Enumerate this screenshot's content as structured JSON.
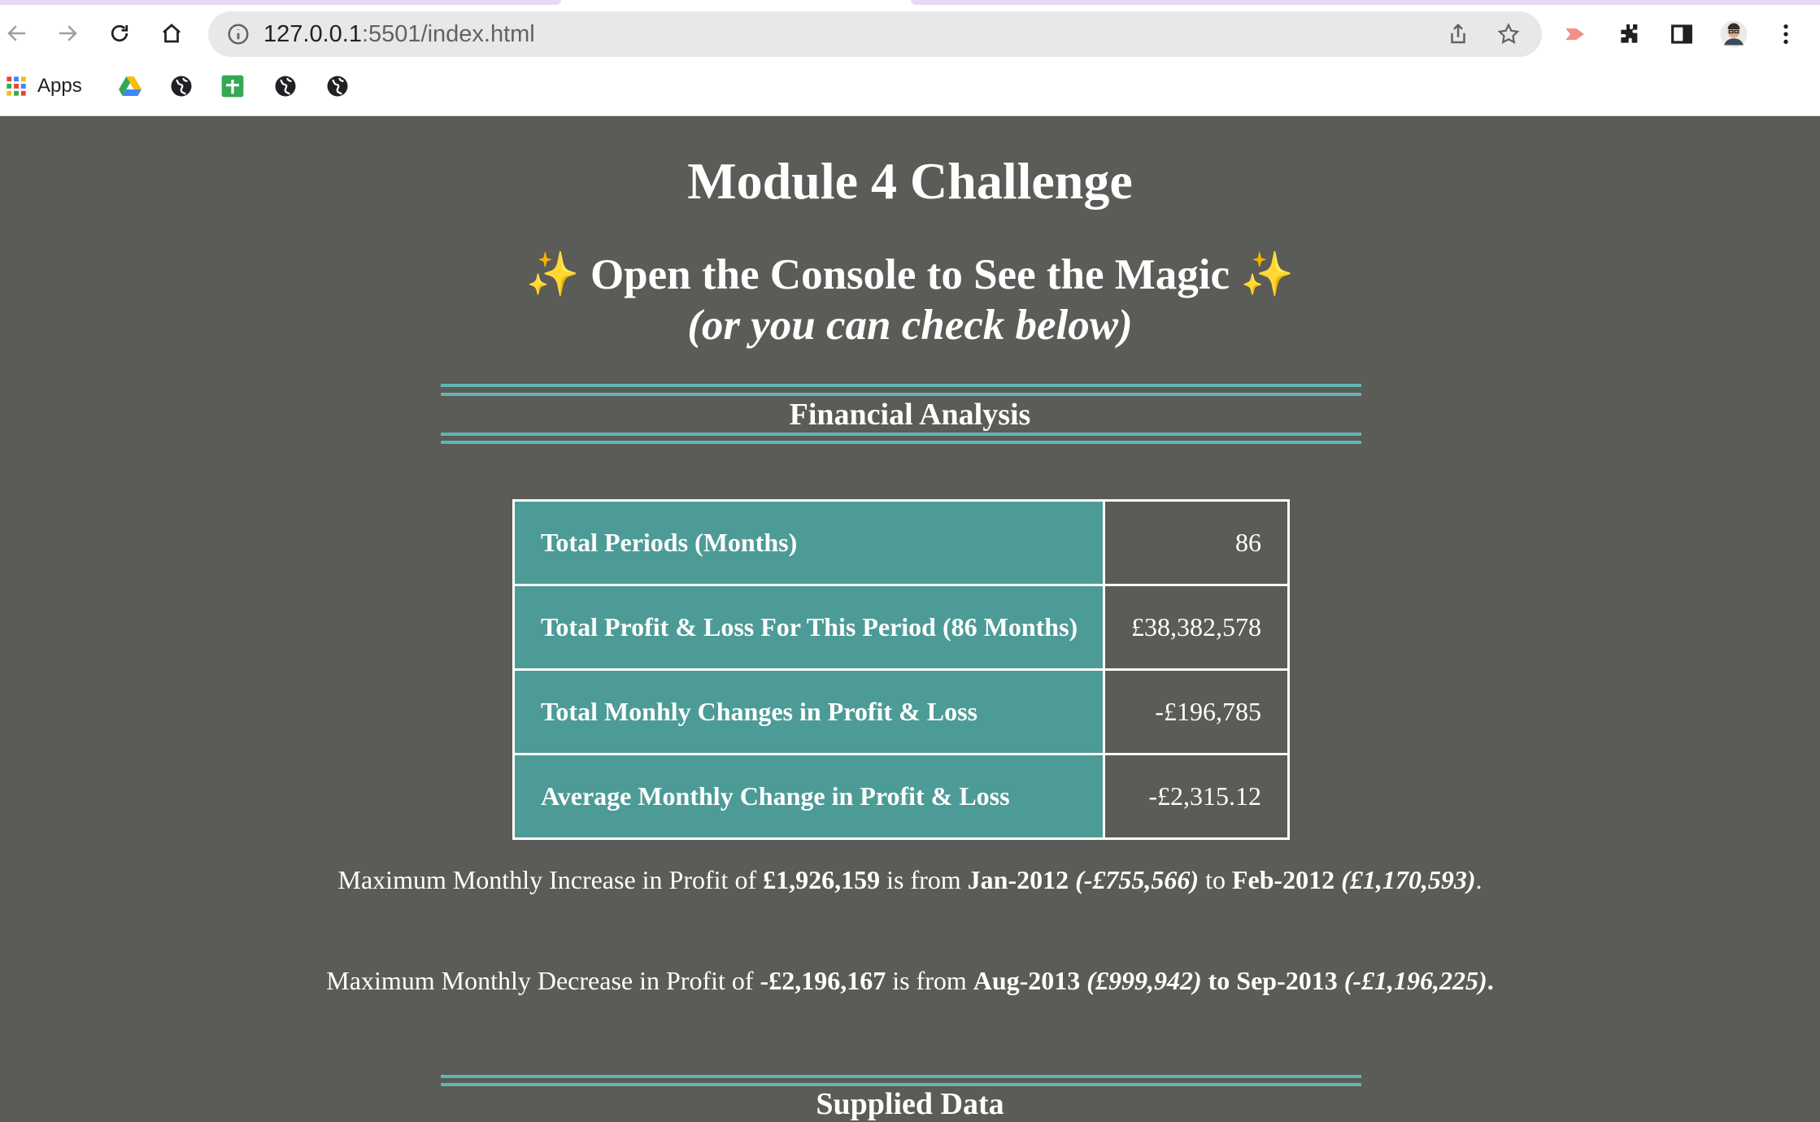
{
  "browser": {
    "url_host": "127.0.0.1",
    "url_path": ":5501/index.html",
    "bookmarks": [
      {
        "label": "Apps",
        "icon": "apps-grid-icon"
      },
      {
        "label": "",
        "icon": "google-drive-icon"
      },
      {
        "label": "",
        "icon": "globe-icon"
      },
      {
        "label": "",
        "icon": "google-sheets-icon"
      },
      {
        "label": "",
        "icon": "globe-icon"
      },
      {
        "label": "",
        "icon": "globe-icon"
      }
    ]
  },
  "page": {
    "title": "Module 4 Challenge",
    "subtitle_sparkle_left": "✨",
    "subtitle": "Open the Console to See the Magic",
    "subtitle_sparkle_right": "✨",
    "subtitle_2": "(or you can check below)",
    "section_financial": "Financial Analysis",
    "summary_rows": [
      {
        "label": "Total Periods (Months)",
        "value": "86"
      },
      {
        "label": "Total Profit & Loss For This Period (86 Months)",
        "value": "£38,382,578"
      },
      {
        "label": "Total Monhly Changes in Profit & Loss",
        "value": "-£196,785"
      },
      {
        "label": "Average Monthly Change in Profit & Loss",
        "value": "-£2,315.12"
      }
    ],
    "increase": {
      "lead": "Maximum Monthly Increase in Profit of ",
      "amount": "£1,926,159",
      "mid1": " is from ",
      "from_month": "Jan-2012",
      "from_value": " (-£755,566)",
      "mid2": " to ",
      "to_month": "Feb-2012",
      "to_value": " (£1,170,593)",
      "end": "."
    },
    "decrease": {
      "lead": "Maximum Monthly Decrease in Profit of ",
      "amount": "-£2,196,167",
      "mid1": " is from ",
      "from_month": "Aug-2013",
      "from_value": " (£999,942)",
      "mid2": " to ",
      "to_month": "Sep-2013",
      "to_value": " (-£1,196,225)",
      "end": "."
    },
    "section_supplied": "Supplied Data"
  },
  "colors": {
    "page_bg": "#5b5b57",
    "accent_teal": "#5fb6b4",
    "table_label_bg": "#4d9b97",
    "sparkle": "#f6c945"
  }
}
